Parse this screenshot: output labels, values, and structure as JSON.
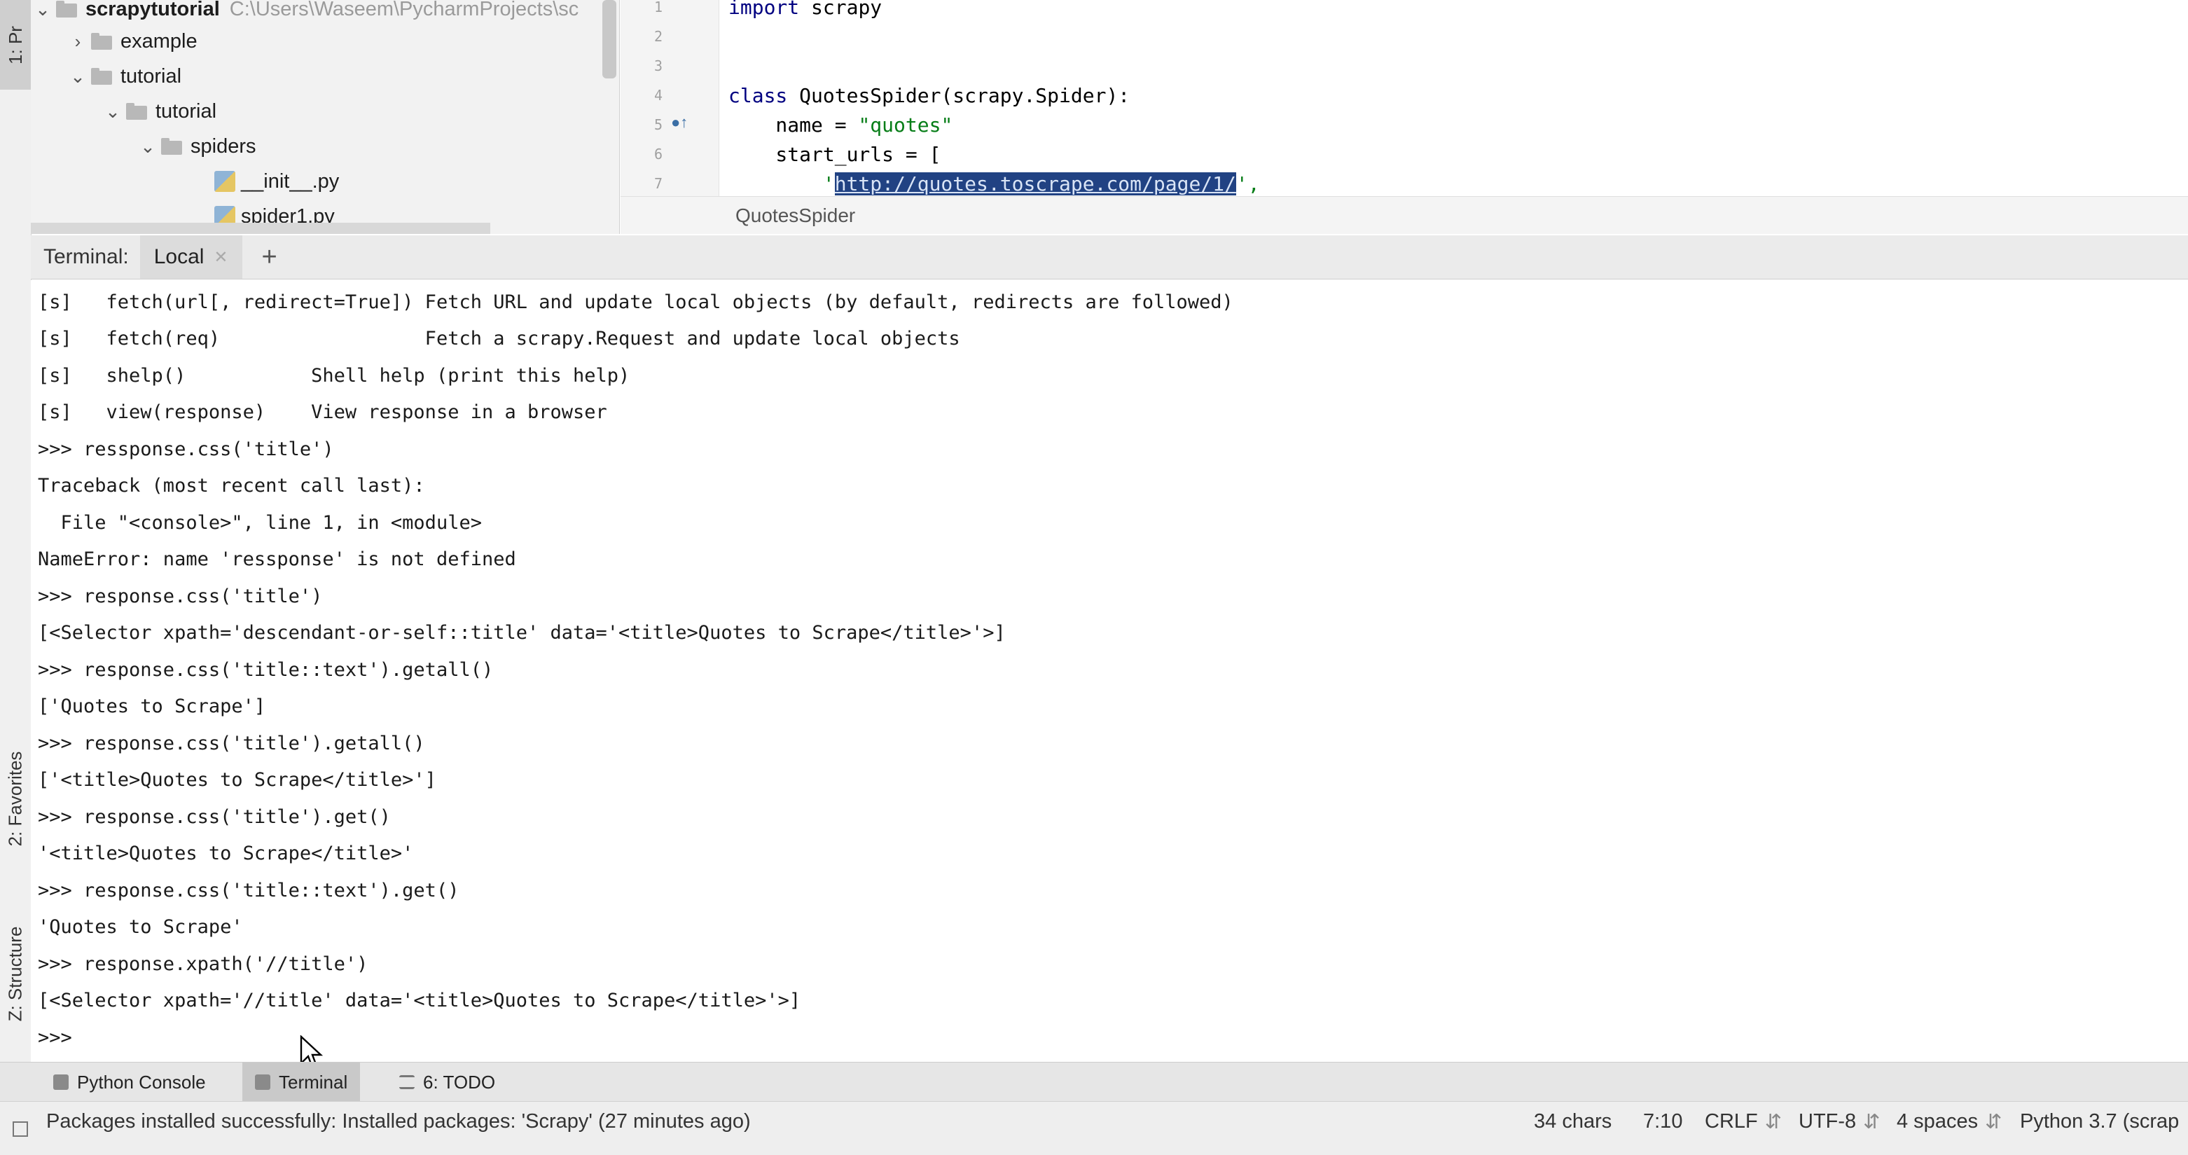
{
  "left_strip": {
    "project_tab": "1: Pr",
    "favorites_tab": "2: Favorites",
    "structure_tab": "Z: Structure"
  },
  "project_tree": {
    "root_name": "scrapytutorial",
    "root_path": "C:\\Users\\Waseem\\PycharmProjects\\sc",
    "items": [
      {
        "label": "example"
      },
      {
        "label": "tutorial"
      },
      {
        "label": "tutorial"
      },
      {
        "label": "spiders"
      },
      {
        "label": "__init__.py"
      },
      {
        "label": "spider1.py"
      }
    ]
  },
  "editor": {
    "line_numbers": [
      "1",
      "2",
      "3",
      "4",
      "5",
      "6",
      "7"
    ],
    "lines": {
      "l1_kw": "import",
      "l1_rest": " scrapy",
      "l4_kw": "class",
      "l4_rest": " QuotesSpider(scrapy.Spider):",
      "l5_pre": "    name = ",
      "l5_str": "\"quotes\"",
      "l6": "    start_urls = [",
      "l7_pre": "        '",
      "l7_sel": "http://quotes.toscrape.com/page/1/",
      "l7_post": "',"
    },
    "breadcrumb": "QuotesSpider"
  },
  "terminal": {
    "header_label": "Terminal:",
    "tab_label": "Local",
    "add_tab": "+",
    "lines": [
      "[s]   fetch(url[, redirect=True]) Fetch URL and update local objects (by default, redirects are followed)",
      "[s]   fetch(req)                  Fetch a scrapy.Request and update local objects",
      "[s]   shelp()           Shell help (print this help)",
      "[s]   view(response)    View response in a browser",
      ">>> ressponse.css('title')",
      "Traceback (most recent call last):",
      "  File \"<console>\", line 1, in <module>",
      "NameError: name 'ressponse' is not defined",
      ">>> response.css('title')",
      "[<Selector xpath='descendant-or-self::title' data='<title>Quotes to Scrape</title>'>]",
      ">>> response.css('title::text').getall()",
      "['Quotes to Scrape']",
      ">>> response.css('title').getall()",
      "['<title>Quotes to Scrape</title>']",
      ">>> response.css('title').get()",
      "'<title>Quotes to Scrape</title>'",
      ">>> response.css('title::text').get()",
      "'Quotes to Scrape'",
      ">>> response.xpath('//title')",
      "[<Selector xpath='//title' data='<title>Quotes to Scrape</title>'>]",
      ">>> "
    ]
  },
  "tool_windows": {
    "python_console": "Python Console",
    "terminal": "Terminal",
    "todo": "6: TODO"
  },
  "status_bar": {
    "message": "Packages installed successfully: Installed packages: 'Scrapy' (27 minutes ago)",
    "chars": "34 chars",
    "position": "7:10",
    "line_sep": "CRLF",
    "encoding": "UTF-8",
    "indent": "4 spaces",
    "interpreter": "Python 3.7 (scrap"
  }
}
